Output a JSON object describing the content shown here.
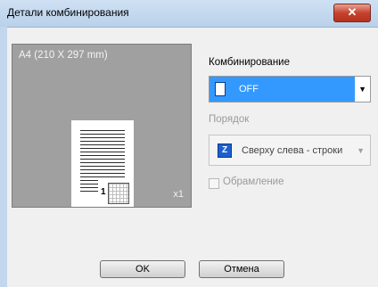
{
  "window": {
    "title": "Детали комбинирования",
    "close_glyph": "✕"
  },
  "preview": {
    "paper_label": "A4  (210 X 297 mm)",
    "page_number": "1",
    "copies_label": "x1"
  },
  "combine": {
    "label": "Комбинирование",
    "value": "OFF"
  },
  "order": {
    "label": "Порядок",
    "value": "Сверху слева - строки",
    "icon_glyph": "Z"
  },
  "border": {
    "label": "Обрамление",
    "checked": false
  },
  "buttons": {
    "ok": "OK",
    "cancel": "Отмена"
  },
  "colors": {
    "selection": "#3399ff",
    "preview_bg": "#a0a0a0",
    "close": "#c6422d"
  }
}
